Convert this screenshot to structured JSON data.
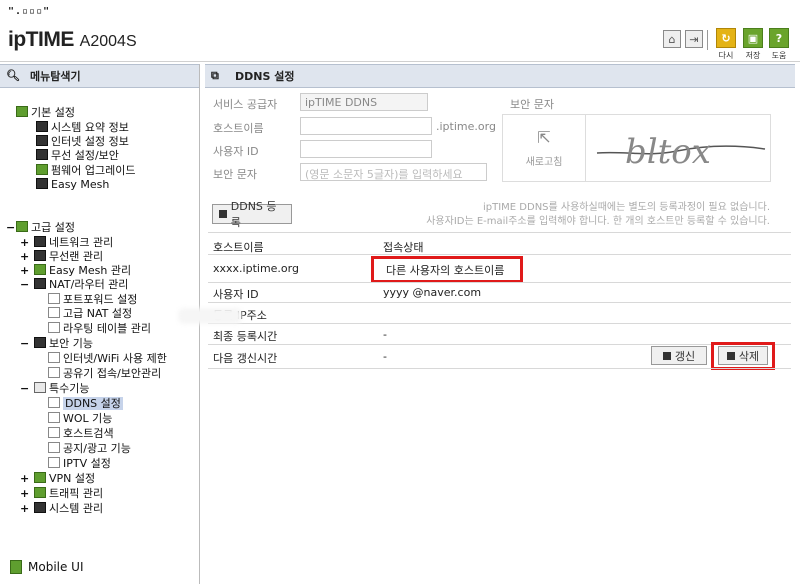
{
  "header": {
    "logo_dots": "\".▫▫▫\"",
    "brand": "ipTIME",
    "model": "A2004S",
    "buttons": [
      {
        "icon": "home-icon"
      },
      {
        "icon": "logout-icon"
      },
      {
        "icon": "refresh-icon",
        "label": "다시"
      },
      {
        "icon": "save-icon",
        "label": "저장"
      },
      {
        "icon": "help-icon",
        "label": "도움",
        "glyph": "?"
      }
    ]
  },
  "sidebar": {
    "title": "메뉴탐색기",
    "basic": {
      "label": "기본 설정",
      "items": [
        "시스템 요약 정보",
        "인터넷 설정 정보",
        "무선 설정/보안",
        "펌웨어 업그레이드",
        "Easy Mesh"
      ]
    },
    "advanced": {
      "label": "고급 설정",
      "items": [
        {
          "sign": "+",
          "label": "네트워크 관리"
        },
        {
          "sign": "+",
          "label": "무선랜 관리"
        },
        {
          "sign": "+",
          "label": "Easy Mesh 관리"
        },
        {
          "sign": "−",
          "label": "NAT/라우터 관리"
        },
        {
          "sign": "",
          "label": "포트포워드 설정"
        },
        {
          "sign": "",
          "label": "고급 NAT 설정"
        },
        {
          "sign": "",
          "label": "라우팅 테이블 관리"
        },
        {
          "sign": "−",
          "label": "보안 기능"
        },
        {
          "sign": "",
          "label": "인터넷/WiFi 사용 제한"
        },
        {
          "sign": "",
          "label": "공유기 접속/보안관리"
        },
        {
          "sign": "−",
          "label": "특수기능"
        },
        {
          "sign": "",
          "label": "DDNS 설정"
        },
        {
          "sign": "",
          "label": "WOL 기능"
        },
        {
          "sign": "",
          "label": "호스트검색"
        },
        {
          "sign": "",
          "label": "공지/광고 기능"
        },
        {
          "sign": "",
          "label": "IPTV 설정"
        },
        {
          "sign": "+",
          "label": "VPN 설정"
        },
        {
          "sign": "+",
          "label": "트래픽 관리"
        },
        {
          "sign": "+",
          "label": "시스템 관리"
        }
      ]
    },
    "mobile_ui": "Mobile UI"
  },
  "ddns": {
    "title": "DDNS 설정",
    "provider_label": "서비스 공급자",
    "provider_value": "ipTIME DDNS",
    "host_label": "호스트이름",
    "host_suffix": ".iptime.org",
    "user_label": "사용자 ID",
    "captcha_label": "보안 문자",
    "captcha_placeholder": "(영문 소문자 5글자)를 입력하세요",
    "captcha_box_label": "보안 문자",
    "refresh_label": "새로고침",
    "captcha_text": "bltox",
    "register_button": "DDNS 등록",
    "hint_line1": "ipTIME DDNS를 사용하실때에는 별도의 등록과정이 필요 없습니다.",
    "hint_line2": "사용자ID는 E-mail주소를 입력해야 합니다. 한 개의 호스트만 등록할 수 있습니다.",
    "table": {
      "col_host": "호스트이름",
      "col_status": "접속상태",
      "host_value": "xxxx.iptime.org",
      "status_value": "다른 사용자의 호스트이름",
      "user_label": "사용자 ID",
      "user_value": "yyyy @naver.com",
      "ip_label": "등록 IP주소",
      "last_label": "최종 등록시간",
      "last_value": "-",
      "next_label": "다음 갱신시간",
      "next_value": "-",
      "renew_button": "갱신",
      "delete_button": "삭제"
    }
  }
}
